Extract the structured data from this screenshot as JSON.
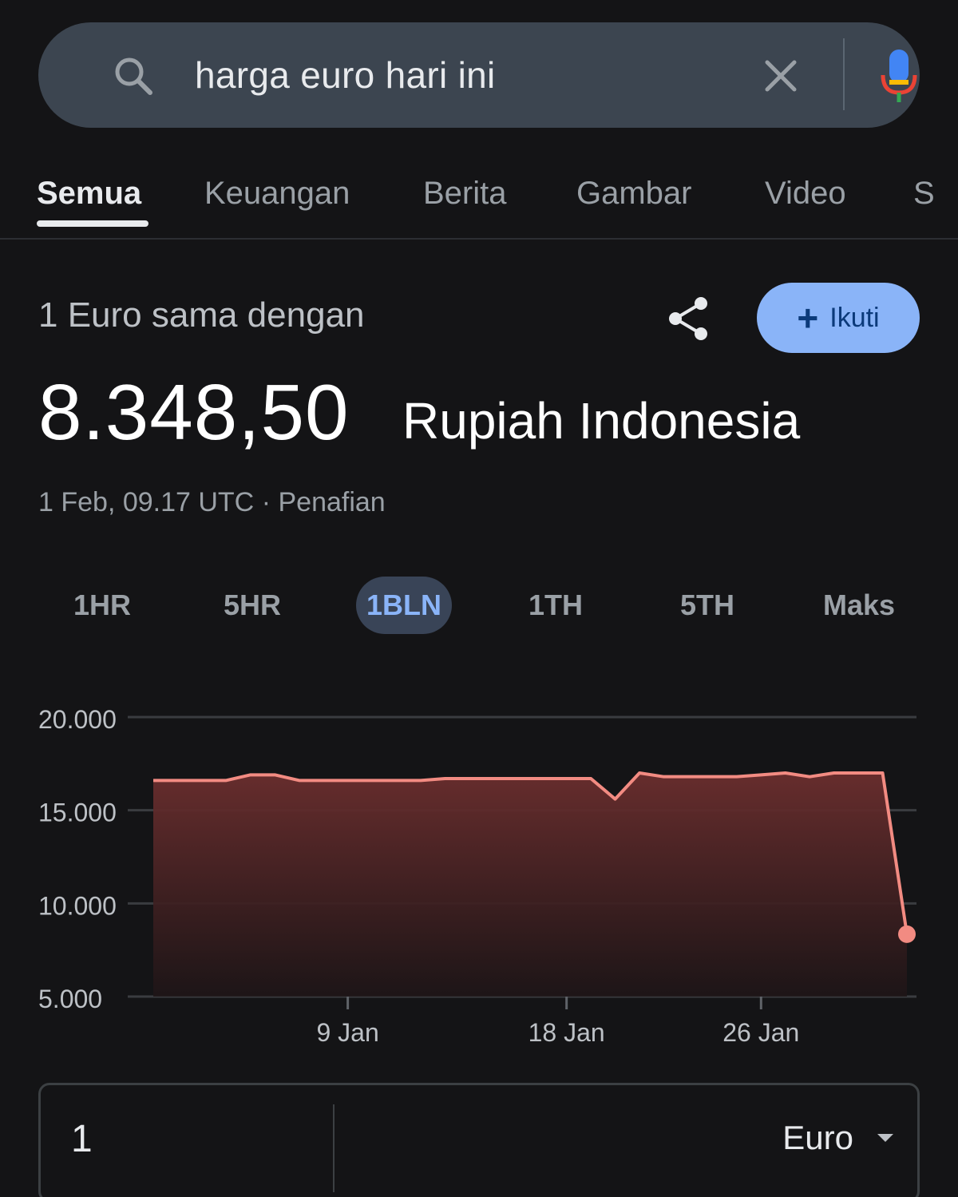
{
  "search": {
    "query": "harga euro hari ini",
    "icon": "search-icon",
    "clear_icon": "close-icon",
    "mic_icon": "mic-icon"
  },
  "tabs": [
    {
      "label": "Semua",
      "active": true
    },
    {
      "label": "Keuangan",
      "active": false
    },
    {
      "label": "Berita",
      "active": false
    },
    {
      "label": "Gambar",
      "active": false
    },
    {
      "label": "Video",
      "active": false
    },
    {
      "label": "S",
      "active": false
    }
  ],
  "result": {
    "equals_label": "1 Euro sama dengan",
    "follow_label": "Ikuti",
    "value": "8.348,50",
    "currency": "Rupiah Indonesia",
    "timestamp": "1 Feb, 09.17 UTC",
    "separator": "·",
    "disclaimer": "Penafian"
  },
  "ranges": [
    {
      "label": "1HR",
      "active": false
    },
    {
      "label": "5HR",
      "active": false
    },
    {
      "label": "1BLN",
      "active": true
    },
    {
      "label": "1TH",
      "active": false
    },
    {
      "label": "5TH",
      "active": false
    },
    {
      "label": "Maks",
      "active": false
    }
  ],
  "chart_data": {
    "type": "area",
    "title": "",
    "xlabel": "",
    "ylabel": "",
    "ylim": [
      5000,
      20000
    ],
    "yticks": [
      20000,
      15000,
      10000,
      5000
    ],
    "ytick_labels": [
      "20.000",
      "15.000",
      "10.000",
      "5.000"
    ],
    "xtick_labels": [
      "9 Jan",
      "18 Jan",
      "26 Jan"
    ],
    "xtick_days": [
      9,
      18,
      26
    ],
    "series": [
      {
        "day": [
          1,
          2,
          3,
          4,
          5,
          6,
          7,
          8,
          9,
          10,
          11,
          12,
          13,
          14,
          15,
          16,
          17,
          18,
          19,
          20,
          21,
          22,
          23,
          24,
          25,
          26,
          27,
          28,
          29,
          30,
          31,
          32
        ],
        "values": [
          16600,
          16600,
          16600,
          16600,
          16900,
          16900,
          16600,
          16600,
          16600,
          16600,
          16600,
          16600,
          16700,
          16700,
          16700,
          16700,
          16700,
          16700,
          16700,
          15600,
          17000,
          16800,
          16800,
          16800,
          16800,
          16900,
          17000,
          16800,
          17000,
          17000,
          17000,
          8348.5
        ]
      }
    ],
    "line_color": "#f28b82",
    "grid": true,
    "legend": "none"
  },
  "converter": {
    "amount": "1",
    "currency": "Euro"
  }
}
